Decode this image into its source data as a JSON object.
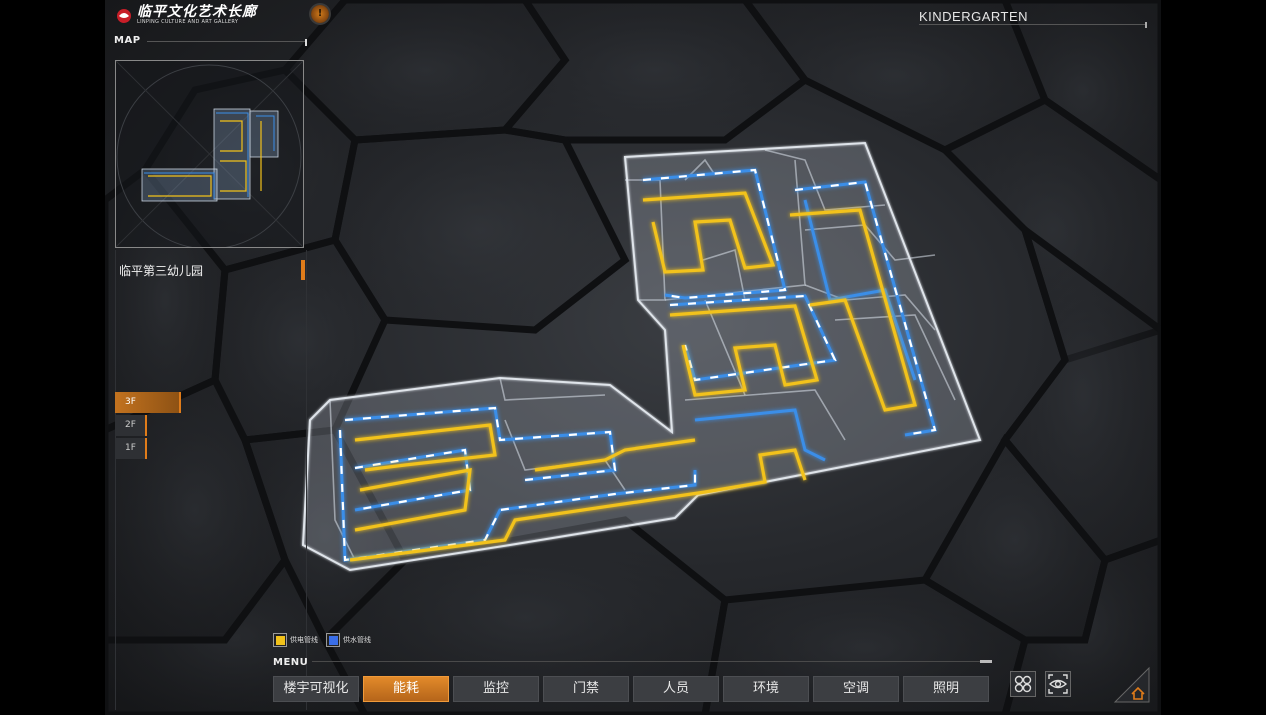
{
  "header": {
    "logo_cn": "临平文化艺术长廊",
    "logo_en": "LINPING CULTURE AND ART GALLERY",
    "alert_symbol": "!",
    "building_tag": "KINDERGARTEN"
  },
  "map": {
    "title": "MAP",
    "school_name": "临平第三幼儿园"
  },
  "floors": [
    {
      "label": "3F",
      "active": true
    },
    {
      "label": "2F",
      "active": false
    },
    {
      "label": "1F",
      "active": false
    }
  ],
  "legend": {
    "power": "供电管线",
    "water": "供水管线"
  },
  "menu": {
    "title": "MENU",
    "items": [
      "楼宇可视化",
      "能耗",
      "监控",
      "门禁",
      "人员",
      "环境",
      "空调",
      "照明"
    ],
    "active_index": 1
  },
  "colors": {
    "accent": "#e07c1a",
    "power_line": "#f2c21a",
    "water_line": "#3a8ee8",
    "wall": "#d8dde4"
  },
  "icons": {
    "logo": "gallery-logo-icon",
    "alert": "alert-icon",
    "layout": "quad-layout-icon",
    "view": "eye-view-icon",
    "home": "home-icon"
  }
}
